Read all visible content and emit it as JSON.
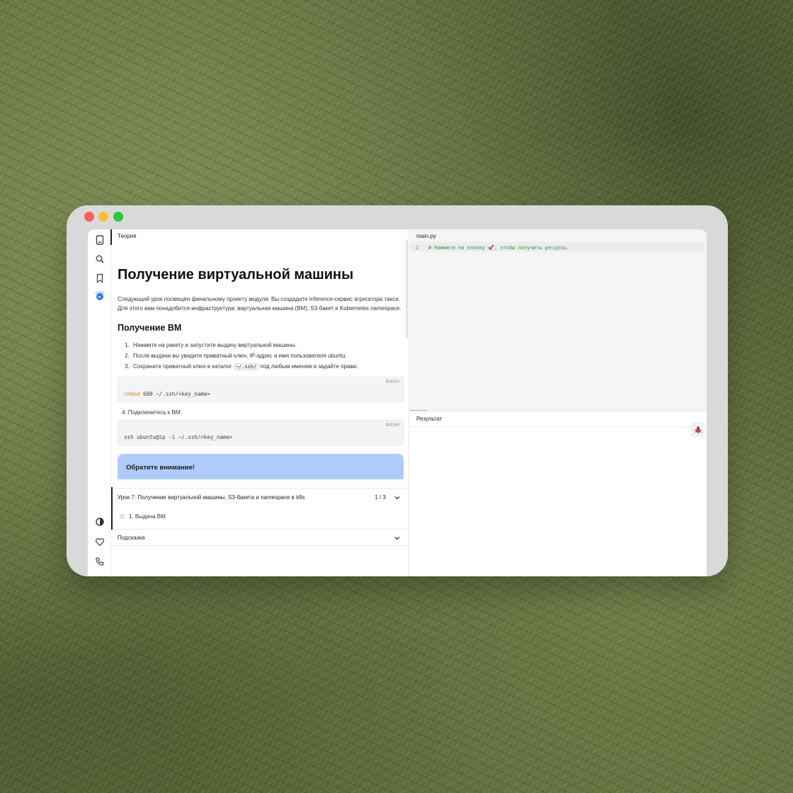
{
  "theory": {
    "tab_label": "Теория",
    "title": "Получение виртуальной машины",
    "intro": "Следующий урок посвящён финальному проекту модуля. Вы создадите inference-сервис агрегатора такси. Для этого вам понадобится инфраструктура: виртуальная машина (ВМ), S3-бакет и Kubernetes namespace.",
    "section_title": "Получение ВМ",
    "steps": [
      "Нажмите на ракету и запустите выдачу виртуальной машины.",
      "После выдачи вы увидите приватный ключ, IP-адрес и имя пользователя ubuntu."
    ],
    "step3_before": "Сохраните приватный ключ в каталог",
    "step3_code": "~/.ssh/",
    "step3_after": "под любым именем и задайте права:",
    "code1": {
      "lang": "BASH",
      "keyword": "chmod",
      "rest": " 600 ~/.ssh/<key_name>"
    },
    "step4": "4.  Подключитесь к ВМ:",
    "code2": {
      "lang": "BASH",
      "line": "ssh ubuntu@ip -i ~/.ssh/<key_name>"
    },
    "note_title": "Обратите внимание!"
  },
  "lesson": {
    "title": "Урок 7: Получение виртуальной машины, S3-бакета и namespace в k8s",
    "counter": "1 / 3",
    "task": "1. Выдача ВМ"
  },
  "hint": {
    "label": "Подсказка"
  },
  "editor": {
    "file_tab": "main.py",
    "line_number": "1",
    "comment": "# Нажмите на кнопку 🚀, чтобы получить ресурсы."
  },
  "result": {
    "label": "Результат"
  },
  "icons": {
    "rail": [
      "book-icon",
      "search-icon",
      "bookmark-icon",
      "avatar",
      "contrast-icon",
      "heart-icon",
      "phone-icon"
    ],
    "bug": "bug-icon"
  },
  "colors": {
    "note_bg": "#aecbfa",
    "comment": "#2e9a46",
    "keyword": "#d48a2a"
  }
}
